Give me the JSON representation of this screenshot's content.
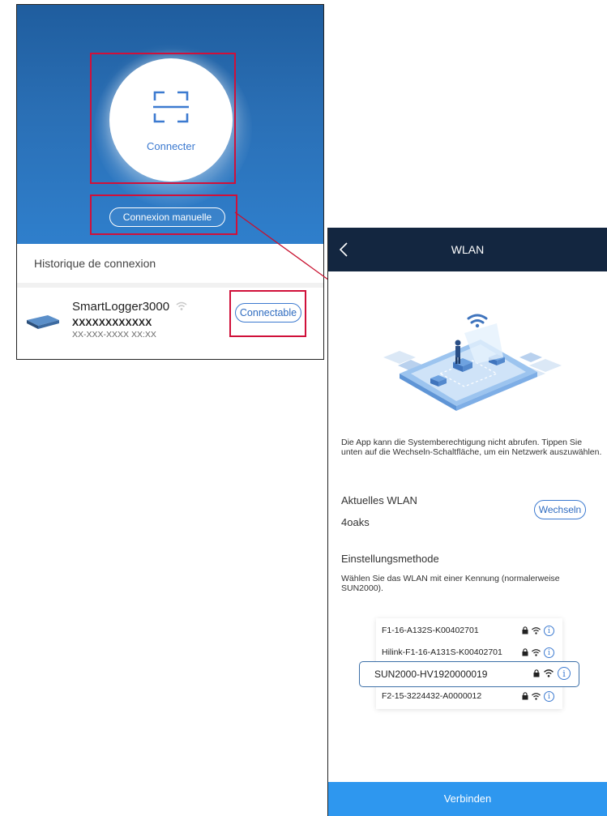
{
  "left_screen": {
    "connect_label": "Connecter",
    "manual_button_label": "Connexion manuelle",
    "history_title": "Historique de connexion",
    "device": {
      "name": "SmartLogger3000",
      "serial": "XXXXXXXXXXXX",
      "address": "XX-XXX-XXXX XX:XX",
      "action_label": "Connectable"
    }
  },
  "right_screen": {
    "title": "WLAN",
    "message": "Die App kann die Systemberechtigung nicht abrufen. Tippen Sie unten auf die Wechseln-Schaltfläche, um ein Netzwerk auszuwählen.",
    "current_wlan_label": "Aktuelles WLAN",
    "current_wlan_value": "4oaks",
    "switch_button_label": "Wechseln",
    "method_label": "Einstellungsmethode",
    "method_description": "Wählen Sie das WLAN mit einer Kennung (normalerweise SUN2000).",
    "networks": [
      {
        "name": "F1-16-A132S-K00402701"
      },
      {
        "name": "Hilink-F1-16-A131S-K00402701"
      },
      {
        "name": "SUN2000-HV1920000019"
      },
      {
        "name": "F2-15-3224432-A0000012"
      }
    ],
    "info_glyph": "i",
    "connect_button_label": "Verbinden"
  },
  "colors": {
    "hero_blue": "#2a6fb5",
    "highlight_red": "#d0103a",
    "topbar_navy": "#132640",
    "accent_blue": "#3c7ad0",
    "connect_bar_blue": "#2e97ef"
  },
  "icons": [
    "scan-icon",
    "wifi-icon",
    "lock-icon",
    "info-icon",
    "back-icon",
    "device-icon"
  ]
}
